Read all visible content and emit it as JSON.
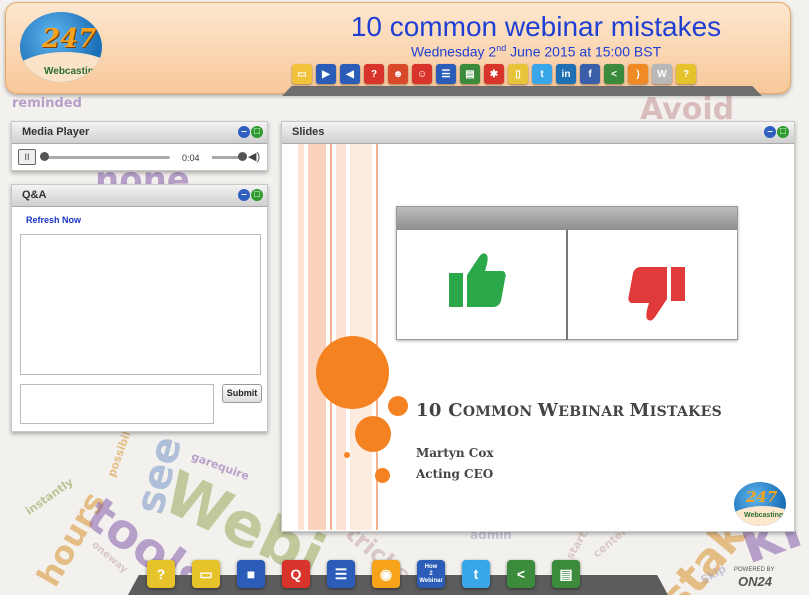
{
  "header": {
    "title": "10 common webinar mistakes",
    "subtitle_weekday": "Wednesday 2",
    "subtitle_ordinal": "nd",
    "subtitle_rest": " June 2015 at 15:00 BST",
    "logo_number": "247",
    "logo_text": "Webcasting",
    "toolbar_icons": [
      {
        "name": "slides-icon",
        "color": "#f2c23a",
        "glyph": "▭"
      },
      {
        "name": "media-player-icon",
        "color": "#2a5cb8",
        "glyph": "▶"
      },
      {
        "name": "speaker-icon",
        "color": "#2a5cb8",
        "glyph": "◀"
      },
      {
        "name": "qa-icon",
        "color": "#d9342b",
        "glyph": "?"
      },
      {
        "name": "people-icon",
        "color": "#d94a2b",
        "glyph": "☻"
      },
      {
        "name": "group-icon",
        "color": "#d9342b",
        "glyph": "☺"
      },
      {
        "name": "profile-icon",
        "color": "#2a5cb8",
        "glyph": "☰"
      },
      {
        "name": "folder-icon",
        "color": "#3c8a3c",
        "glyph": "▤"
      },
      {
        "name": "network-icon",
        "color": "#d9342b",
        "glyph": "✱"
      },
      {
        "name": "document-icon",
        "color": "#e9c43a",
        "glyph": "▯"
      },
      {
        "name": "twitter-icon",
        "color": "#39a6e8",
        "glyph": "t"
      },
      {
        "name": "linkedin-icon",
        "color": "#1f6fb3",
        "glyph": "in"
      },
      {
        "name": "facebook-icon",
        "color": "#3b5ea8",
        "glyph": "f"
      },
      {
        "name": "share-icon",
        "color": "#3c8a3c",
        "glyph": "<"
      },
      {
        "name": "rss-icon",
        "color": "#f08a24",
        "glyph": ")"
      },
      {
        "name": "wikipedia-icon",
        "color": "#b8b8b8",
        "glyph": "W"
      },
      {
        "name": "help-icon",
        "color": "#e6c22b",
        "glyph": "?"
      }
    ]
  },
  "media_player": {
    "title": "Media Player",
    "time": "0:04",
    "play_glyph": "II",
    "progress": 0.0
  },
  "qa": {
    "title": "Q&A",
    "refresh_label": "Refresh Now",
    "submit_label": "Submit",
    "history_value": "",
    "input_value": ""
  },
  "slides": {
    "title": "Slides",
    "slide_title_first": "10 C",
    "slide_title_rest": "OMMON ",
    "slide_title_w": "W",
    "slide_title_ebinar": "EBINAR ",
    "slide_title_m": "M",
    "slide_title_istakes": "ISTAKES",
    "presenter": "Martyn Cox",
    "role": "Acting CEO",
    "logo_number": "247",
    "logo_text": "Webcasting"
  },
  "dock": {
    "icons": [
      {
        "name": "dock-help-icon",
        "color": "#e6c22b",
        "glyph": "?"
      },
      {
        "name": "dock-slides-icon",
        "color": "#e6c22b",
        "glyph": "▭"
      },
      {
        "name": "dock-video-icon",
        "color": "#2a5cb8",
        "glyph": "■"
      },
      {
        "name": "dock-qa-icon",
        "color": "#d9342b",
        "glyph": "Q"
      },
      {
        "name": "dock-profile-icon",
        "color": "#2a5cb8",
        "glyph": "☰"
      },
      {
        "name": "dock-webcasting-icon",
        "color": "#f7a21b",
        "glyph": "◉"
      },
      {
        "name": "dock-how-to-webinar-icon",
        "color": "#2a5cb8",
        "glyph": "?"
      },
      {
        "name": "dock-twitter-icon",
        "color": "#39a6e8",
        "glyph": "t"
      },
      {
        "name": "dock-share-icon",
        "color": "#3c8a3c",
        "glyph": "<"
      },
      {
        "name": "dock-folder-icon",
        "color": "#3c8a3c",
        "glyph": "▤"
      }
    ],
    "how_label_top": "How",
    "how_label_mid": "2",
    "how_label_bottom": "Webinar",
    "powered_by": "POWERED BY",
    "on24": "ON24"
  },
  "background_words": [
    {
      "text": "reminded",
      "color": "#7b4fa6"
    },
    {
      "text": "Avoid",
      "color": "#c08b8b"
    },
    {
      "text": "none",
      "color": "#7b4fa6"
    },
    {
      "text": "see",
      "color": "#6d8cc6"
    },
    {
      "text": "hours",
      "color": "#d68b1e"
    },
    {
      "text": "tools",
      "color": "#7b4fa6"
    },
    {
      "text": "Webi",
      "color": "#8ca34a"
    },
    {
      "text": "instantly",
      "color": "#7b9a3a"
    },
    {
      "text": "possibility",
      "color": "#d68b1e"
    },
    {
      "text": "garequire",
      "color": "#7b4fa6"
    },
    {
      "text": "oneway",
      "color": "#c0a0a0"
    },
    {
      "text": "admin",
      "color": "#9a9ac0"
    },
    {
      "text": "stakes",
      "color": "#d68b1e"
    },
    {
      "text": "starts",
      "color": "#c0a0a0"
    },
    {
      "text": "center",
      "color": "#c0a0a0"
    },
    {
      "text": "ki",
      "color": "#7b4fa6"
    },
    {
      "text": "tricks",
      "color": "#c0a0a0"
    },
    {
      "text": "Skip",
      "color": "#9a9ac0"
    }
  ]
}
